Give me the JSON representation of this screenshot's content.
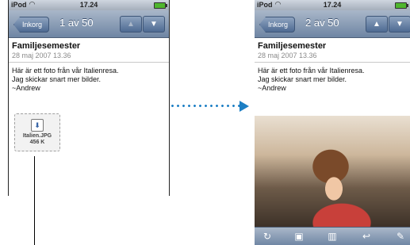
{
  "status": {
    "carrier": "iPod",
    "time": "17.24"
  },
  "nav": {
    "back_label": "Inkorg",
    "left_counter": "1 av 50",
    "right_counter": "2 av 50"
  },
  "message": {
    "subject": "Familjesemester",
    "date": "28 maj 2007 13.36",
    "line1": "Här är ett foto från vår Italienresa.",
    "line2": "Jag skickar snart mer bilder.",
    "signature": "~Andrew"
  },
  "attachment": {
    "name": "Italien.JPG",
    "size": "456 K",
    "icon": "download-icon"
  },
  "toolbar_icons": [
    "refresh-icon",
    "move-folder-icon",
    "trash-icon",
    "reply-icon",
    "compose-icon"
  ],
  "colors": {
    "accent_blue": "#1d7fc4",
    "nav_blue": "#6e85a3"
  }
}
